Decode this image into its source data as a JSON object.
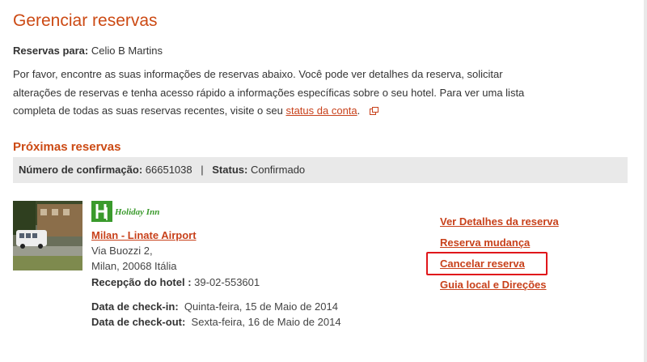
{
  "page": {
    "title": "Gerenciar reservas",
    "owner_label": "Reservas para:",
    "owner_name": "Celio B Martins",
    "intro_text": "Por favor, encontre as suas informações de reservas abaixo. Você pode ver detalhes da reserva, solicitar alterações de reservas e tenha acesso rápido a informações específicas sobre o seu hotel. Para ver uma lista completa de todas as suas reservas recentes, visite o seu",
    "account_link": "status da conta",
    "intro_end": ".",
    "external_icon": "external-window-icon"
  },
  "upcoming": {
    "title": "Próximas reservas",
    "confirmation_label": "Número de confirmação:",
    "confirmation_number": "66651038",
    "separator": "|",
    "status_label": "Status:",
    "status_value": "Confirmado"
  },
  "hotel": {
    "brand_text": "Holiday Inn",
    "brand_color": "#3a9a2c",
    "name": "Milan - Linate Airport",
    "street": "Via Buozzi 2,",
    "city_line": "Milan,  20068 Itália",
    "phone_label": "Recepção do hotel :",
    "phone": "39-02-553601",
    "checkin_label": "Data de check-in:",
    "checkin": "Quinta-feira, 15 de Maio de 2014",
    "checkout_label": "Data de check-out:",
    "checkout": "Sexta-feira, 16 de Maio de 2014"
  },
  "actions": [
    {
      "label": "Ver Detalhes da reserva"
    },
    {
      "label": "Reserva mudança"
    },
    {
      "label": "Cancelar reserva"
    },
    {
      "label": "Guia local e Direções"
    }
  ],
  "colors": {
    "accent": "#cc4a14",
    "link": "#c8411b",
    "highlight_border": "#e0161b",
    "bar_bg": "#e9e9e9"
  }
}
